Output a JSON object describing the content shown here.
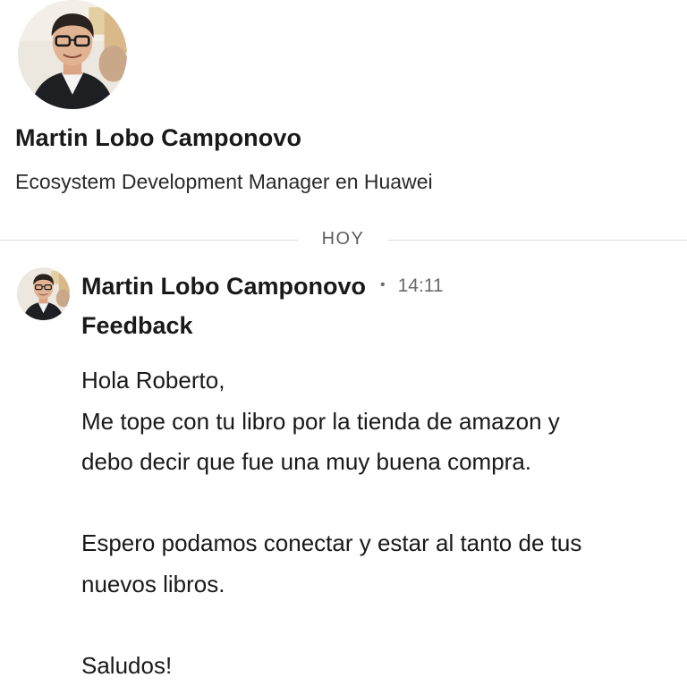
{
  "profile": {
    "name": "Martin Lobo Camponovo",
    "headline": "Ecosystem Development Manager en Huawei"
  },
  "divider": {
    "label": "HOY"
  },
  "message": {
    "sender": "Martin Lobo Camponovo",
    "separator": "•",
    "time": "14:11",
    "subject": "Feedback",
    "body_lines": [
      "Hola Roberto,",
      "Me tope con tu libro por la tienda de amazon y",
      "debo decir que fue una muy buena compra.",
      "",
      "Espero podamos conectar y estar al tanto de tus",
      "nuevos libros.",
      "",
      "Saludos!"
    ]
  },
  "colors": {
    "text_primary": "#191919",
    "text_secondary": "#6b6b6b",
    "divider": "#d9d9d9",
    "background": "#ffffff"
  }
}
